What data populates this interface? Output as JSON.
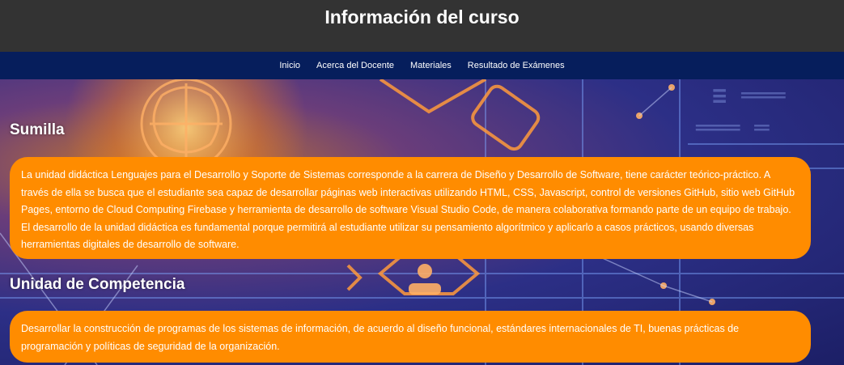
{
  "header": {
    "title": "Información del curso"
  },
  "nav": {
    "items": [
      {
        "label": "Inicio"
      },
      {
        "label": "Acerca del Docente"
      },
      {
        "label": "Materiales"
      },
      {
        "label": "Resultado de Exámenes"
      }
    ]
  },
  "sumilla": {
    "heading": "Sumilla",
    "text": "La unidad didáctica Lenguajes para el Desarrollo y Soporte de Sistemas corresponde a la carrera de Diseño y Desarrollo de Software, tiene carácter teórico-práctico. A través de ella se busca que el estudiante sea capaz de desarrollar páginas web interactivas utilizando HTML, CSS, Javascript, control de versiones GitHub, sitio web GitHub Pages, entorno de Cloud Computing Firebase y herramienta de desarrollo de software Visual Studio Code, de manera colaborativa formando parte de un equipo de trabajo. El desarrollo de la unidad didáctica es fundamental porque permitirá al estudiante utilizar su pensamiento algorítmico y aplicarlo a casos prácticos, usando diversas herramientas digitales de desarrollo de software."
  },
  "competencia": {
    "heading": "Unidad de Competencia",
    "text": "Desarrollar la construcción de programas de los sistemas de información, de acuerdo al diseño funcional, estándares internacionales de TI, buenas prácticas de programación y políticas de seguridad de la organización."
  },
  "colors": {
    "header_bg": "#333333",
    "nav_bg": "#061e5c",
    "box_bg": "#ff8c00",
    "text": "#ffffff"
  }
}
